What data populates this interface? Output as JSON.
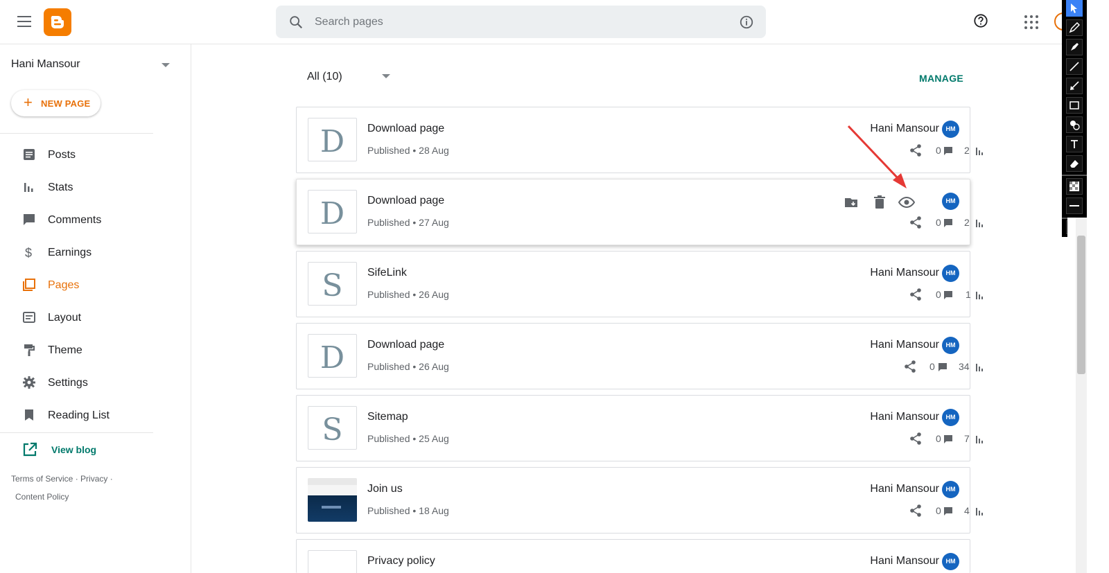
{
  "search": {
    "placeholder": "Search pages"
  },
  "sidebar": {
    "blog_name": "Hani Mansour",
    "new_page_label": "NEW PAGE",
    "items": [
      {
        "label": "Posts",
        "icon": "posts-icon"
      },
      {
        "label": "Stats",
        "icon": "stats-icon"
      },
      {
        "label": "Comments",
        "icon": "comments-icon"
      },
      {
        "label": "Earnings",
        "icon": "dollar-icon"
      },
      {
        "label": "Pages",
        "icon": "pages-icon",
        "active": true
      },
      {
        "label": "Layout",
        "icon": "layout-icon"
      },
      {
        "label": "Theme",
        "icon": "paint-roller-icon"
      },
      {
        "label": "Settings",
        "icon": "gear-icon"
      },
      {
        "label": "Reading List",
        "icon": "bookmark-icon"
      }
    ],
    "view_blog_label": "View blog",
    "footer": {
      "terms": "Terms of Service",
      "sep1": "·",
      "privacy": "Privacy",
      "sep2": "·",
      "content_policy": "Content Policy"
    }
  },
  "main": {
    "filter_label": "All (10)",
    "manage_label": "MANAGE",
    "pages": [
      {
        "thumb": "D",
        "title": "Download page",
        "status": "Published • 28 Aug",
        "author": "Hani Mansour",
        "comments": "0",
        "views": "2"
      },
      {
        "thumb": "D",
        "title": "Download page",
        "status": "Published • 27 Aug",
        "author": "",
        "comments": "0",
        "views": "2",
        "hover": true
      },
      {
        "thumb": "S",
        "title": "SifeLink",
        "status": "Published • 26 Aug",
        "author": "Hani Mansour",
        "comments": "0",
        "views": "1"
      },
      {
        "thumb": "D",
        "title": "Download page",
        "status": "Published • 26 Aug",
        "author": "Hani Mansour",
        "comments": "0",
        "views": "34"
      },
      {
        "thumb": "S",
        "title": "Sitemap",
        "status": "Published • 25 Aug",
        "author": "Hani Mansour",
        "comments": "0",
        "views": "7"
      },
      {
        "thumb": "",
        "title": "Join us",
        "status": "Published • 18 Aug",
        "author": "Hani Mansour",
        "comments": "0",
        "views": "4",
        "image": true
      },
      {
        "thumb": "",
        "title": "Privacy policy",
        "status": "",
        "author": "Hani Mansour",
        "comments": "",
        "views": ""
      }
    ]
  },
  "colors": {
    "accent": "#e8710a",
    "link": "#00796b",
    "annotation": "#e53935"
  }
}
